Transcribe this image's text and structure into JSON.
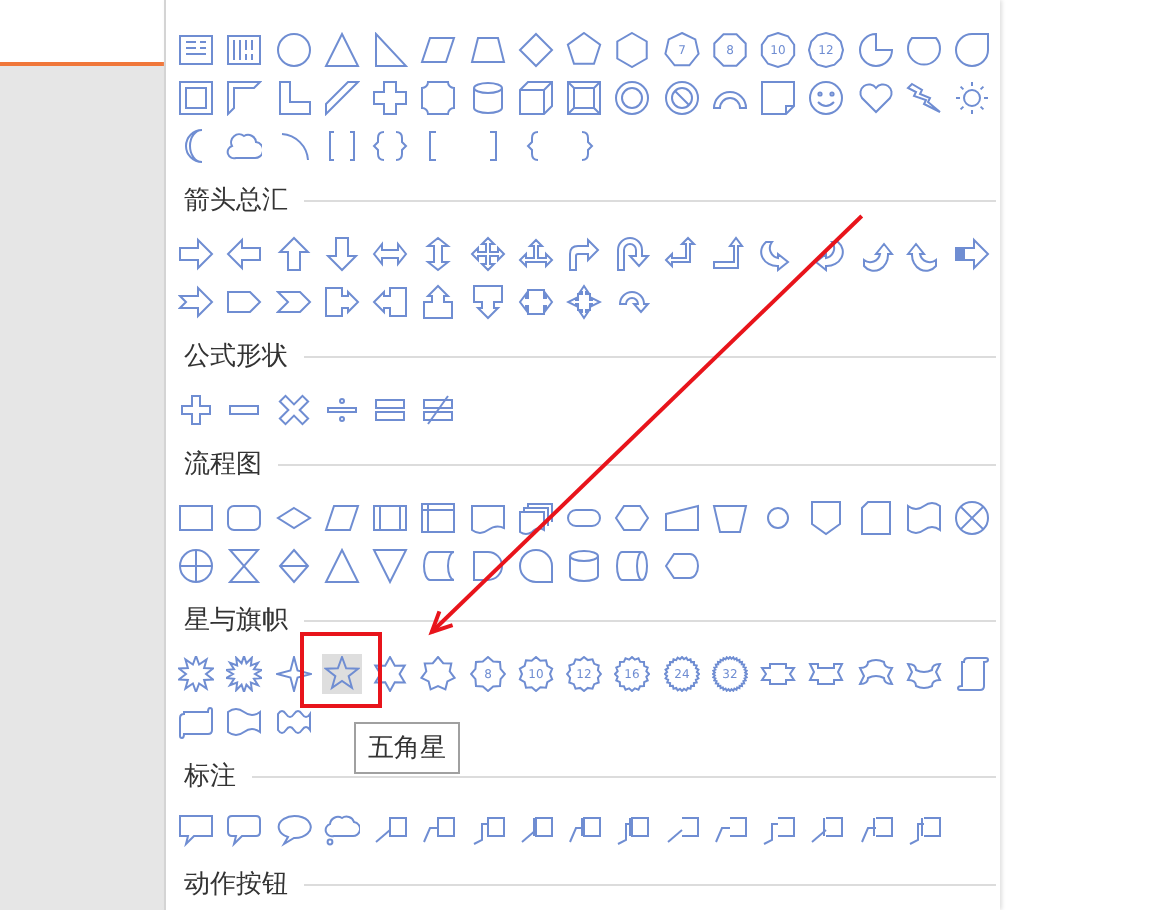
{
  "sections": [
    {
      "shapes": [
        {
          "kind": "textbox",
          "selected": false
        },
        {
          "kind": "vtextbox",
          "selected": false
        },
        {
          "kind": "ellipse",
          "selected": false
        },
        {
          "kind": "triangle",
          "selected": false
        },
        {
          "kind": "righttriangle",
          "selected": false
        },
        {
          "kind": "parallelogram",
          "selected": false
        },
        {
          "kind": "trapezoid",
          "selected": false
        },
        {
          "kind": "diamond",
          "selected": false
        },
        {
          "kind": "pentagon",
          "selected": false
        },
        {
          "kind": "hexagon",
          "selected": false
        },
        {
          "kind": "heptagon",
          "label": "7",
          "selected": false
        },
        {
          "kind": "octagon",
          "label": "8",
          "selected": false
        },
        {
          "kind": "decagon",
          "label": "10",
          "selected": false
        },
        {
          "kind": "dodecagon",
          "label": "12",
          "selected": false
        },
        {
          "kind": "pie",
          "selected": false
        },
        {
          "kind": "chord",
          "selected": false
        },
        {
          "kind": "teardrop",
          "selected": false
        },
        {
          "kind": "frame",
          "selected": false
        },
        {
          "kind": "halfframe",
          "selected": false
        },
        {
          "kind": "lshape",
          "selected": false
        },
        {
          "kind": "diagstripe",
          "selected": false
        },
        {
          "kind": "plus",
          "selected": false
        },
        {
          "kind": "plaque",
          "selected": false
        },
        {
          "kind": "can",
          "selected": false
        },
        {
          "kind": "cube",
          "selected": false
        },
        {
          "kind": "bevel",
          "selected": false
        },
        {
          "kind": "donut",
          "selected": false
        },
        {
          "kind": "nosymbol",
          "selected": false
        },
        {
          "kind": "blockarc",
          "selected": false
        },
        {
          "kind": "foldedcorner",
          "selected": false
        },
        {
          "kind": "smiley",
          "selected": false
        },
        {
          "kind": "heart",
          "selected": false
        },
        {
          "kind": "lightning",
          "selected": false
        },
        {
          "kind": "sun",
          "selected": false
        },
        {
          "kind": "moon",
          "selected": false
        },
        {
          "kind": "cloud",
          "selected": false
        },
        {
          "kind": "arc",
          "selected": false
        },
        {
          "kind": "bracketpair",
          "selected": false
        },
        {
          "kind": "bracepair",
          "selected": false
        },
        {
          "kind": "leftbracket",
          "selected": false
        },
        {
          "kind": "rightbracket",
          "selected": false
        },
        {
          "kind": "leftbrace",
          "selected": false
        },
        {
          "kind": "rightbrace",
          "selected": false
        }
      ]
    },
    {
      "title": "箭头总汇",
      "shapes": [
        {
          "kind": "arrowright",
          "selected": false
        },
        {
          "kind": "arrowleft",
          "selected": false
        },
        {
          "kind": "arrowup",
          "selected": false
        },
        {
          "kind": "arrowdown",
          "selected": false
        },
        {
          "kind": "arrowleftright",
          "selected": false
        },
        {
          "kind": "arrowupdown",
          "selected": false
        },
        {
          "kind": "arrowquad",
          "selected": false
        },
        {
          "kind": "arrowleftrightup",
          "selected": false
        },
        {
          "kind": "arrowbent",
          "selected": false
        },
        {
          "kind": "arrowuturn",
          "selected": false
        },
        {
          "kind": "arrowleftup",
          "selected": false
        },
        {
          "kind": "arrowbentup",
          "selected": false
        },
        {
          "kind": "curvedright",
          "selected": false
        },
        {
          "kind": "curvedleft",
          "selected": false
        },
        {
          "kind": "curvedup",
          "selected": false
        },
        {
          "kind": "curveddown",
          "selected": false
        },
        {
          "kind": "stripedright",
          "selected": false
        },
        {
          "kind": "notchedright",
          "selected": false
        },
        {
          "kind": "homeplate",
          "selected": false
        },
        {
          "kind": "chevron",
          "selected": false
        },
        {
          "kind": "calloutright",
          "selected": false
        },
        {
          "kind": "calloutleft",
          "selected": false
        },
        {
          "kind": "calloutup",
          "selected": false
        },
        {
          "kind": "calloutdown",
          "selected": false
        },
        {
          "kind": "calloutleftright",
          "selected": false
        },
        {
          "kind": "calloutquad",
          "selected": false
        },
        {
          "kind": "circulararrow",
          "selected": false
        }
      ]
    },
    {
      "title": "公式形状",
      "shapes": [
        {
          "kind": "mathplus",
          "selected": false
        },
        {
          "kind": "mathminus",
          "selected": false
        },
        {
          "kind": "mathmultiply",
          "selected": false
        },
        {
          "kind": "mathdivide",
          "selected": false
        },
        {
          "kind": "mathequal",
          "selected": false
        },
        {
          "kind": "mathnotequal",
          "selected": false
        }
      ]
    },
    {
      "title": "流程图",
      "shapes": [
        {
          "kind": "process",
          "selected": false
        },
        {
          "kind": "alternateprocess",
          "selected": false
        },
        {
          "kind": "decision",
          "selected": false
        },
        {
          "kind": "data",
          "selected": false
        },
        {
          "kind": "predefined",
          "selected": false
        },
        {
          "kind": "internalstorage",
          "selected": false
        },
        {
          "kind": "document",
          "selected": false
        },
        {
          "kind": "multidocument",
          "selected": false
        },
        {
          "kind": "terminator",
          "selected": false
        },
        {
          "kind": "preparation",
          "selected": false
        },
        {
          "kind": "manualinput",
          "selected": false
        },
        {
          "kind": "manualoperation",
          "selected": false
        },
        {
          "kind": "connector",
          "selected": false
        },
        {
          "kind": "offpage",
          "selected": false
        },
        {
          "kind": "card",
          "selected": false
        },
        {
          "kind": "tape",
          "selected": false
        },
        {
          "kind": "summing",
          "selected": false
        },
        {
          "kind": "or",
          "selected": false
        },
        {
          "kind": "collate",
          "selected": false
        },
        {
          "kind": "sort",
          "selected": false
        },
        {
          "kind": "extract",
          "selected": false
        },
        {
          "kind": "merge",
          "selected": false
        },
        {
          "kind": "storeddata",
          "selected": false
        },
        {
          "kind": "delay",
          "selected": false
        },
        {
          "kind": "sequential",
          "selected": false
        },
        {
          "kind": "magneticdisk",
          "selected": false
        },
        {
          "kind": "directaccess",
          "selected": false
        },
        {
          "kind": "display",
          "selected": false
        }
      ]
    },
    {
      "title": "星与旗帜",
      "shapes": [
        {
          "kind": "explosion1",
          "selected": false
        },
        {
          "kind": "explosion2",
          "selected": false
        },
        {
          "kind": "star4",
          "selected": false
        },
        {
          "kind": "star5",
          "selected": true,
          "tooltip": "五角星"
        },
        {
          "kind": "star6",
          "selected": false
        },
        {
          "kind": "star7",
          "selected": false
        },
        {
          "kind": "star8",
          "label": "8",
          "selected": false
        },
        {
          "kind": "star10",
          "label": "10",
          "selected": false
        },
        {
          "kind": "star12",
          "label": "12",
          "selected": false
        },
        {
          "kind": "star16",
          "label": "16",
          "selected": false
        },
        {
          "kind": "star24",
          "label": "24",
          "selected": false
        },
        {
          "kind": "star32",
          "label": "32",
          "selected": false
        },
        {
          "kind": "ribbondown",
          "selected": false
        },
        {
          "kind": "ribbonup",
          "selected": false
        },
        {
          "kind": "ellipseribbon",
          "selected": false
        },
        {
          "kind": "ellipseribbonup",
          "selected": false
        },
        {
          "kind": "verticalscroll",
          "selected": false
        },
        {
          "kind": "horizontalscroll",
          "selected": false
        },
        {
          "kind": "wave",
          "selected": false
        },
        {
          "kind": "doublewave",
          "selected": false
        }
      ]
    },
    {
      "title": "标注",
      "shapes": [
        {
          "kind": "wedgerect",
          "selected": false
        },
        {
          "kind": "wedgeroundrect",
          "selected": false
        },
        {
          "kind": "wedgeellipse",
          "selected": false
        },
        {
          "kind": "cloudcallout",
          "selected": false
        },
        {
          "kind": "line1",
          "selected": false
        },
        {
          "kind": "line2",
          "selected": false
        },
        {
          "kind": "line3",
          "selected": false
        },
        {
          "kind": "accent1",
          "selected": false
        },
        {
          "kind": "accent2",
          "selected": false
        },
        {
          "kind": "accent3",
          "selected": false
        },
        {
          "kind": "plain1",
          "selected": false
        },
        {
          "kind": "plain2",
          "selected": false
        },
        {
          "kind": "plain3",
          "selected": false
        },
        {
          "kind": "border1",
          "selected": false
        },
        {
          "kind": "border2",
          "selected": false
        },
        {
          "kind": "border3",
          "selected": false
        }
      ]
    },
    {
      "title": "动作按钮"
    }
  ],
  "annotations": {
    "arrow": true,
    "frame": true
  }
}
